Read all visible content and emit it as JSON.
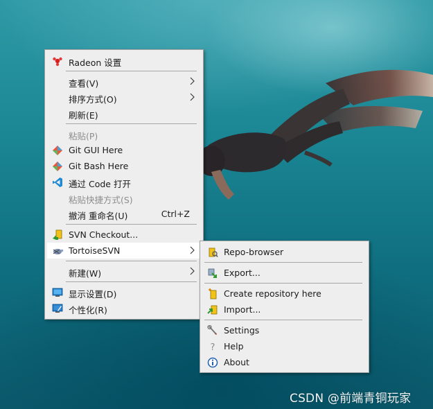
{
  "main_menu": {
    "items": [
      {
        "label": "Radeon 设置",
        "icon": "radeon-icon"
      },
      {
        "label": "查看(V)",
        "submenu": true
      },
      {
        "label": "排序方式(O)",
        "submenu": true
      },
      {
        "label": "刷新(E)"
      },
      {
        "label": "粘贴(P)",
        "disabled": true
      },
      {
        "label": "Git GUI Here",
        "icon": "git-icon"
      },
      {
        "label": "Git Bash Here",
        "icon": "git-icon"
      },
      {
        "label": "通过 Code 打开",
        "icon": "vscode-icon"
      },
      {
        "label": "粘贴快捷方式(S)",
        "disabled": true
      },
      {
        "label": "撤消 重命名(U)",
        "shortcut": "Ctrl+Z"
      },
      {
        "label": "SVN Checkout...",
        "icon": "svn-checkout-icon"
      },
      {
        "label": "TortoiseSVN",
        "icon": "tortoisesvn-icon",
        "submenu": true,
        "highlighted": true
      },
      {
        "label": "新建(W)",
        "submenu": true
      },
      {
        "label": "显示设置(D)",
        "icon": "display-icon"
      },
      {
        "label": "个性化(R)",
        "icon": "personalize-icon"
      }
    ]
  },
  "svn_submenu": {
    "items": [
      {
        "label": "Repo-browser",
        "icon": "repo-browser-icon"
      },
      {
        "label": "Export...",
        "icon": "export-icon"
      },
      {
        "label": "Create repository here",
        "icon": "create-repo-icon"
      },
      {
        "label": "Import...",
        "icon": "import-icon"
      },
      {
        "label": "Settings",
        "icon": "settings-icon"
      },
      {
        "label": "Help",
        "icon": "help-icon"
      },
      {
        "label": "About",
        "icon": "about-icon"
      }
    ]
  },
  "watermark": "CSDN @前端青铜玩家",
  "colors": {
    "menu_bg": "#eeeeee",
    "hover_bg": "#ffffff",
    "separator": "#a6a6a6",
    "disabled_text": "#8d8d8d"
  }
}
